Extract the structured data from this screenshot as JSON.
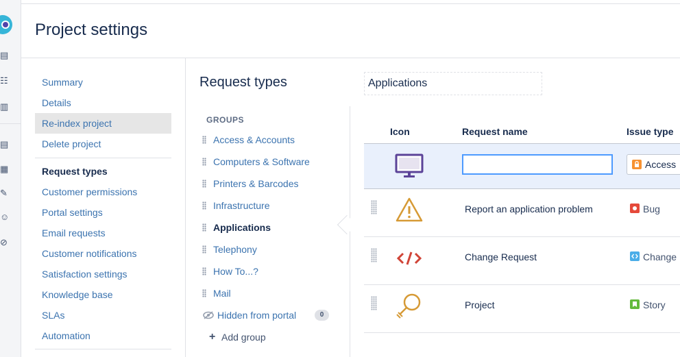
{
  "page": {
    "title": "Project settings"
  },
  "settings_nav": {
    "group1": [
      "Summary",
      "Details",
      "Re-index project",
      "Delete project"
    ],
    "current": "Request types",
    "group2": [
      "Customer permissions",
      "Portal settings",
      "Email requests",
      "Customer notifications",
      "Satisfaction settings",
      "Knowledge base",
      "SLAs",
      "Automation"
    ]
  },
  "request_types": {
    "title": "Request types",
    "groups_header": "GROUPS",
    "groups": [
      "Access & Accounts",
      "Computers & Software",
      "Printers & Barcodes",
      "Infrastructure",
      "Applications",
      "Telephony",
      "How To...?",
      "Mail"
    ],
    "active_group": "Applications",
    "hidden_label": "Hidden from portal",
    "hidden_count": "0",
    "add_group_label": "Add group"
  },
  "group_name": "Applications",
  "table": {
    "headers": {
      "icon": "Icon",
      "name": "Request name",
      "type": "Issue type"
    },
    "new_row": {
      "name_value": "",
      "issue_type": "Access",
      "icon": "monitor-icon",
      "issue_color": "#f79232"
    },
    "rows": [
      {
        "icon": "warning-icon",
        "name": "Report an application problem",
        "issue_type": "Bug",
        "issue_color": "#e5493a"
      },
      {
        "icon": "code-icon",
        "name": "Change Request",
        "issue_type": "Change",
        "issue_color": "#4bade8"
      },
      {
        "icon": "lightbulb-icon",
        "name": "Project",
        "issue_type": "Story",
        "issue_color": "#63ba3c"
      }
    ]
  },
  "colors": {
    "link": "#3b73af",
    "text": "#172b4d",
    "focus": "#4c9aff",
    "selected_bg": "#e6e6e6",
    "edit_row_bg": "#e9f0fc"
  }
}
